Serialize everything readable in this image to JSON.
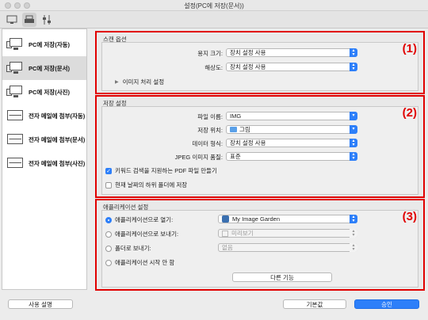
{
  "window": {
    "title": "설정(PC에 저장(문서))"
  },
  "toolbar": {
    "tabs": [
      {
        "icon": "scan-to-pc-icon"
      },
      {
        "icon": "scanner-icon"
      },
      {
        "icon": "general-settings-icon"
      }
    ]
  },
  "sidebar": {
    "items": [
      {
        "label": "PC에 저장(자동)",
        "icon": "pc-icon",
        "selected": false
      },
      {
        "label": "PC에 저장(문서)",
        "icon": "pc-icon",
        "selected": true
      },
      {
        "label": "PC에 저장(사진)",
        "icon": "pc-icon",
        "selected": false
      },
      {
        "label": "전자 메일에 첨부(자동)",
        "icon": "mail-icon",
        "selected": false
      },
      {
        "label": "전자 메일에 첨부(문서)",
        "icon": "mail-icon",
        "selected": false
      },
      {
        "label": "전자 메일에 첨부(사진)",
        "icon": "mail-icon",
        "selected": false
      }
    ]
  },
  "scan_options": {
    "title": "스캔 옵션",
    "number": "(1)",
    "paper_size_label": "용지 크기:",
    "paper_size_value": "장치 설정 사용",
    "resolution_label": "해상도:",
    "resolution_value": "장치 설정 사용",
    "image_processing_label": "이미지 처리 설정"
  },
  "save_settings": {
    "title": "저장 설정",
    "number": "(2)",
    "file_name_label": "파일 이름:",
    "file_name_value": "IMG",
    "save_in_label": "저장 위치:",
    "save_in_value": "그림",
    "data_format_label": "데이터 형식:",
    "data_format_value": "장치 설정 사용",
    "jpeg_quality_label": "JPEG 이미지 품질:",
    "jpeg_quality_value": "표준",
    "keyword_pdf_label": "키워드 검색을 지원하는 PDF 파일 만들기",
    "keyword_pdf_checked": true,
    "subfolder_label": "현재 날짜의 하위 폴더에 저장",
    "subfolder_checked": false
  },
  "app_settings": {
    "title": "애플리케이션 설정",
    "number": "(3)",
    "open_with_label": "애플리케이션으로 열기:",
    "open_with_value": "My Image Garden",
    "send_to_app_label": "애플리케이션으로 보내기:",
    "send_to_app_value": "미리보기",
    "send_to_folder_label": "폴더로 보내기:",
    "send_to_folder_value": "없음",
    "do_not_start_label": "애플리케이션 시작 안 함",
    "more_functions_label": "다른 기능",
    "selected_option": "open_with"
  },
  "footer": {
    "instructions_label": "사용 설명",
    "defaults_label": "기본값",
    "ok_label": "승인"
  },
  "colors": {
    "accent": "#2d7ff9",
    "highlight_border": "#e10000"
  }
}
